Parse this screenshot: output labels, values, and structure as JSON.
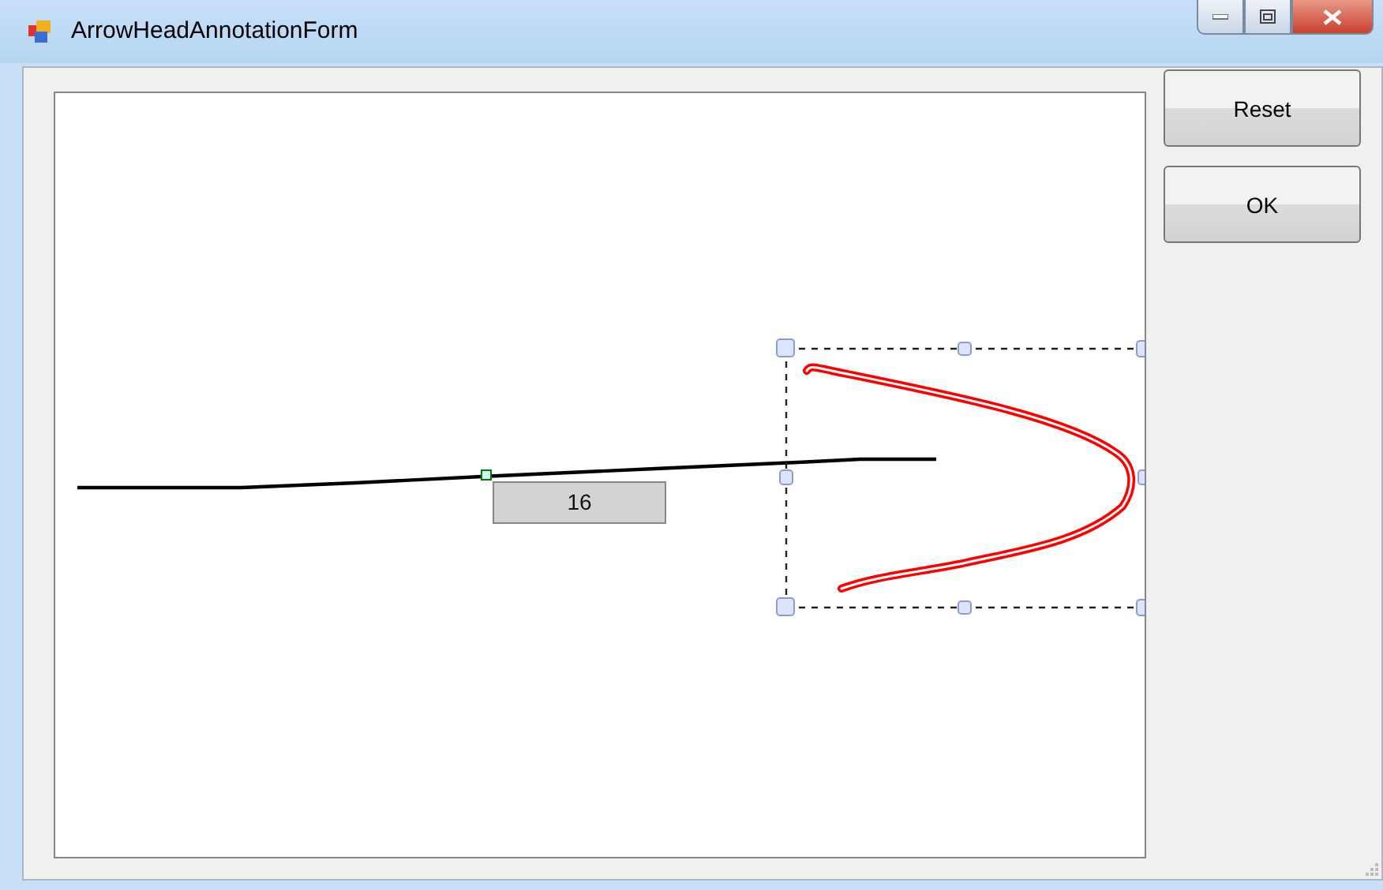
{
  "window": {
    "title": "ArrowHeadAnnotationForm"
  },
  "canvas": {
    "annotation_label": "16"
  },
  "buttons": [
    {
      "label": "Reset"
    },
    {
      "label": "OK"
    }
  ]
}
